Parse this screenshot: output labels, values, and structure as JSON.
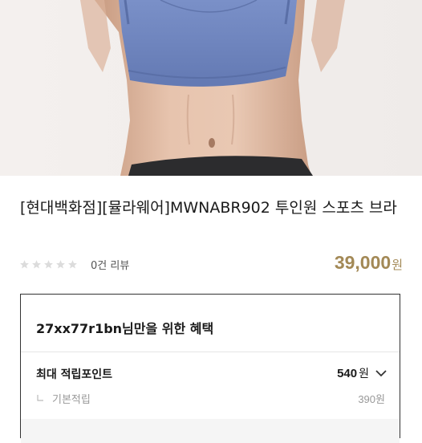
{
  "product": {
    "title": "[현대백화점][뮬라웨어]MWNABR902 투인원 스포츠 브라",
    "review_text": "0건 리뷰",
    "rating_stars": 0,
    "price": "39,000",
    "price_unit": "원"
  },
  "benefit_card": {
    "title": "27xx77r1bn님만을 위한 혜택",
    "point_label": "최대 적립포인트",
    "point_value": "540",
    "point_unit": "원",
    "sub_label": "기본적립",
    "sub_value": "390",
    "sub_unit": "원"
  },
  "icons": {
    "star": "star-icon",
    "chevron": "chevron-down-icon",
    "sub_arrow": "corner-down-right-icon"
  },
  "colors": {
    "price": "#a38956",
    "card_border": "#333333",
    "bra": "#6f86bf"
  }
}
